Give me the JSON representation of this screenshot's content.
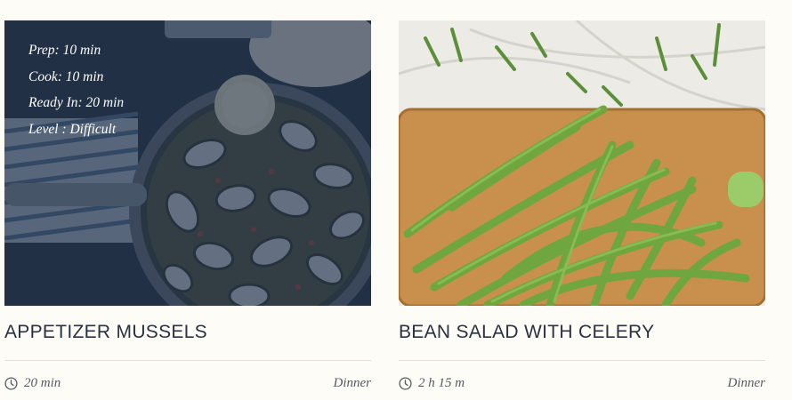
{
  "recipes": [
    {
      "title": "APPETIZER MUSSELS",
      "meta": {
        "prep": "Prep: 10 min",
        "cook": "Cook: 10 min",
        "ready": "Ready In: 20 min",
        "level": "Level : Difficult"
      },
      "time": "20 min",
      "category": "Dinner",
      "image": "mussels-pan-photo"
    },
    {
      "title": "BEAN SALAD WITH CELERY",
      "time": "2 h 15 m",
      "category": "Dinner",
      "image": "green-beans-board-photo"
    }
  ],
  "colors": {
    "background": "#fdfcf7",
    "title": "#2a3140",
    "overlay": "#1c2d48",
    "divider": "#e3e1d8"
  }
}
